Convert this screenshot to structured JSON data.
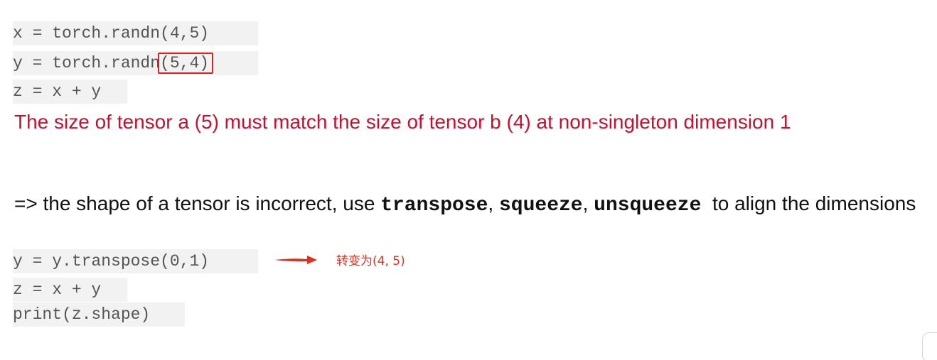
{
  "code_block_1": {
    "line1": "x = torch.randn(4,5)",
    "line2_prefix": "y = torch.randn",
    "line2_highlight": "(5,4)",
    "line3": "z = x + y"
  },
  "error": {
    "message": "The size of tensor a (5) must match the size of tensor b (4) at non-singleton dimension 1"
  },
  "explanation": {
    "prefix": "=> the shape of a tensor is incorrect, use ",
    "fn1": "transpose",
    "sep1": ", ",
    "fn2": "squeeze",
    "sep2": ", ",
    "fn3": "unsqueeze",
    "suffix": "  to align the dimensions"
  },
  "code_block_2": {
    "line1": "y = y.transpose(0,1)",
    "line2": "z = x + y",
    "line3": "print(z.shape)"
  },
  "annotation": {
    "note": "转变为(4, 5)",
    "arrow_color": "#e0301e",
    "highlight_color": "#e02020"
  },
  "colors": {
    "error_text": "#c8102e",
    "code_text": "#555555",
    "code_background": "#f2f2f2"
  }
}
